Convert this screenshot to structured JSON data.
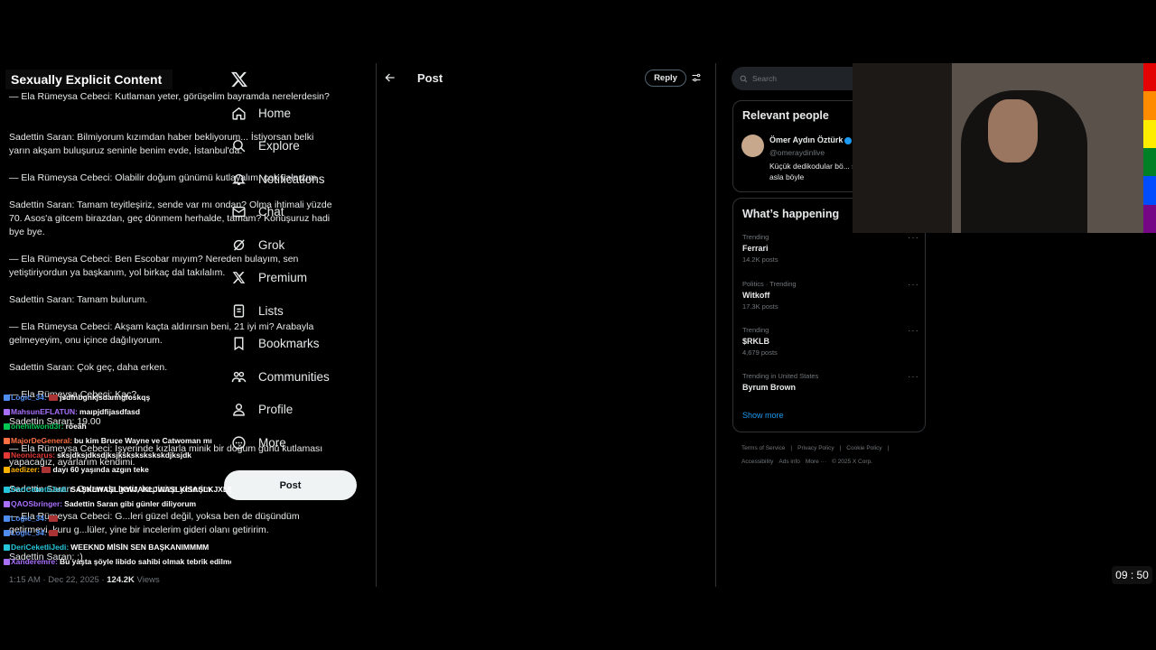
{
  "overlay": {
    "nsfw_label": "Sexually Explicit Content",
    "timer": "09 : 50",
    "flag_colors": [
      "#e40303",
      "#ff8c00",
      "#ffed00",
      "#008026",
      "#004dff",
      "#750787"
    ]
  },
  "chat": [
    {
      "user": "Logic_34:",
      "msg": "jsdfnbgnkjsdanngloskqş",
      "color": "#4f8cf0",
      "emote": true
    },
    {
      "user": "MahsunEFLATUN:",
      "msg": "maıpjdfijasdfasd",
      "color": "#a970ff"
    },
    {
      "user": "onehitwond3r:",
      "msg": "röeah",
      "color": "#00c853"
    },
    {
      "user": "MajorDeGeneral:",
      "msg": "bu kim Bruce Wayne ve Catwoman mı",
      "color": "#ff7043"
    },
    {
      "user": "Neonicarus:",
      "msg": "sksjdksjdksdjksjkskskskskskdjksjdk",
      "color": "#e53935"
    },
    {
      "user": "aedizer:",
      "msg": "dayı 60 yaşında azgın teke",
      "color": "#ffb300",
      "emote": true
    },
    {
      "user": "DeriCeketliJedi:",
      "msg": "SAŞKLWAŞLİKWJAKLJWAŞLKİSAŞLKJXLŞKLKŞAWLKŞALŞWKSA",
      "color": "#26c6da",
      "gap": true
    },
    {
      "user": "QAOSbringer:",
      "msg": "Sadettin Saran gibi günler diliyorum",
      "color": "#a970ff"
    },
    {
      "user": "Logic_34:",
      "msg": "",
      "color": "#4f8cf0",
      "emote": true
    },
    {
      "user": "Logic_34:",
      "msg": "",
      "color": "#4f8cf0",
      "emote": true
    },
    {
      "user": "DeriCeketliJedi:",
      "msg": "WEEKND MİSİN SEN BAŞKANIMMMM",
      "color": "#26c6da"
    },
    {
      "user": "Xanderemre:",
      "msg": "Bu yaşta şöyle libido sahibi olmak tebrik edilmeli",
      "color": "#a970ff"
    }
  ],
  "sidebar": {
    "items": [
      {
        "label": "Home",
        "icon": "home-icon"
      },
      {
        "label": "Explore",
        "icon": "search-icon"
      },
      {
        "label": "Notifications",
        "icon": "bell-icon"
      },
      {
        "label": "Chat",
        "icon": "mail-icon"
      },
      {
        "label": "Grok",
        "icon": "grok-icon"
      },
      {
        "label": "Premium",
        "icon": "x-premium-icon"
      },
      {
        "label": "Lists",
        "icon": "list-icon"
      },
      {
        "label": "Bookmarks",
        "icon": "bookmark-icon"
      },
      {
        "label": "Communities",
        "icon": "people-icon"
      },
      {
        "label": "Profile",
        "icon": "person-icon"
      },
      {
        "label": "More",
        "icon": "more-circle-icon"
      }
    ],
    "post_button": "Post"
  },
  "post": {
    "header_title": "Post",
    "reply_button": "Reply",
    "paragraphs": [
      "— Ela Rümeysa Cebeci: Kutlaman yeter, görüşelim bayramda nerelerdesin?",
      "Sadettin Saran: Bilmiyorum kızımdan haber bekliyorum... İstiyorsan belki yarın akşam buluşuruz seninle benim evde, İstanbul'da.",
      "— Ela Rümeysa Cebeci: Olabilir doğum günümü kutlayalım, çok yalnızım.",
      "Sadettin Saran: Tamam teyitleşiriz, sende var mı ondan? Olma ihtimali yüzde 70. Asos'a gitcem birazdan, geç dönmem herhalde, tamam? Konuşuruz hadi bye bye.",
      "— Ela Rümeysa Cebeci: Ben Escobar mıyım? Nereden bulayım, sen yetiştiriyordun ya başkanım, yol birkaç dal takılalım.",
      "Sadettin Saran: Tamam bulurum.",
      "— Ela Rümeysa Cebeci: Akşam kaçta aldırırsın beni, 21 iyi mi? Arabayla gelmeyeyim, onu içince dağılıyorum.",
      "Sadettin Saran: Çok geç, daha erken.",
      "— Ela Rümeysa Cebeci: Kaç?",
      "Sadettin Saran: 19.00",
      "— Ela Rümeysa Cebeci: İşyerinde kızlarla minik bir doğum günü kutlaması yapacağız, ayarlarım kendimi.",
      "Sadettin Saran: Onları da getir, hepinize yeterim.",
      "— Ela Rümeysa Cebeci: G...leri güzel değil, yoksa ben de düşündüm getirmeyi, kuru g...lüler, yine bir incelerim gideri olanı getiririm.",
      "Sadettin Saran: :)"
    ],
    "meta_time": "1:15 AM · Dec 22, 2025 · ",
    "meta_views_count": "124.2K",
    "meta_views_label": " Views"
  },
  "right": {
    "search_placeholder": "Search",
    "relevant_title": "Relevant people",
    "person_name": "Ömer Aydın Öztürk",
    "person_handle": "@omeraydinlive",
    "person_bio": "Küçük dedikodular bö... skandallar asla böyle",
    "happening_title": "What’s happening",
    "trends": [
      {
        "context": "Trending",
        "topic": "Ferrari",
        "count": "14.2K posts"
      },
      {
        "context": "Politics · Trending",
        "topic": "Witkoff",
        "count": "17.3K posts"
      },
      {
        "context": "Trending",
        "topic": "$RKLB",
        "count": "4,679 posts"
      },
      {
        "context": "Trending in United States",
        "topic": "Byrum Brown",
        "count": ""
      }
    ],
    "show_more": "Show more",
    "footer": [
      "Terms of Service",
      "|",
      "Privacy Policy",
      "|",
      "Cookie Policy",
      "|",
      "Accessibility",
      "Ads info",
      "More ···",
      "© 2025 X Corp."
    ]
  }
}
